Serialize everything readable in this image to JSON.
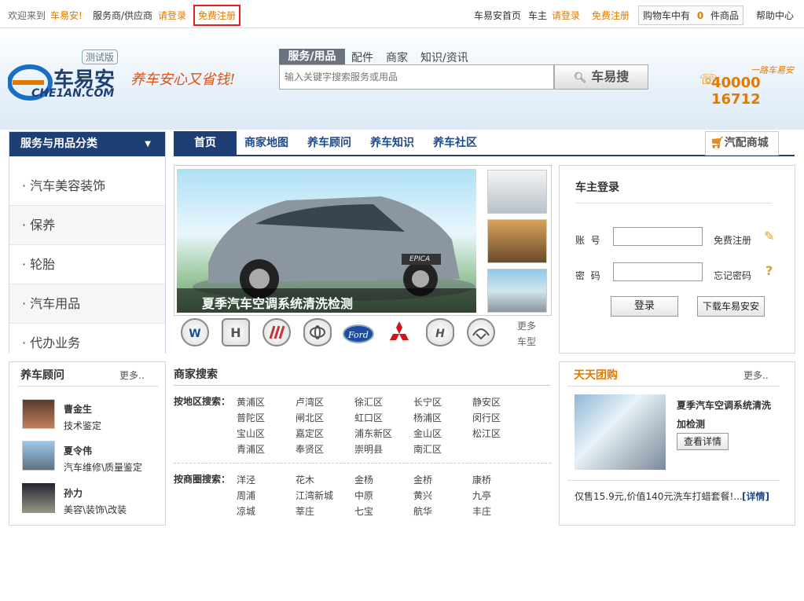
{
  "topbar": {
    "welcome": "欢迎来到",
    "brand": "车易安!",
    "provider": "服务商/供应商",
    "login": "请登录",
    "register": "免费注册",
    "home": "车易安首页",
    "owner": "车主",
    "login2": "请登录",
    "register2": "免费注册",
    "cart_pre": "购物车中有",
    "cart_count": "0",
    "cart_post": "件商品",
    "help": "帮助中心"
  },
  "header": {
    "logo_text": "车易安",
    "logo_sub": "CHE1AN.COM",
    "beta": "测试版",
    "slogan": "养车安心又省钱!",
    "search_tabs": [
      "服务/用品",
      "配件",
      "商家",
      "知识/资讯"
    ],
    "search_placeholder": "输入关键字搜索服务或用品",
    "search_button": "车易搜",
    "hotline_label": "一路车易安",
    "hotline": "40000 16712"
  },
  "left_menu": {
    "title": "服务与用品分类",
    "items": [
      "· 汽车美容装饰",
      "· 保养",
      "· 轮胎",
      "· 汽车用品",
      "· 代办业务"
    ]
  },
  "nav": {
    "tabs": [
      "首页",
      "商家地图",
      "养车顾问",
      "养车知识",
      "养车社区"
    ],
    "mall": "汽配商城"
  },
  "banner": {
    "caption": "夏季汽车空调系统清洗检测",
    "car_badge": "EPICA"
  },
  "brands": {
    "names": [
      "Volkswagen",
      "Honda",
      "Buick",
      "Toyota",
      "Ford",
      "Mitsubishi",
      "Hyundai",
      "Mazda"
    ],
    "more1": "更多",
    "more2": "车型"
  },
  "login": {
    "title": "车主登录",
    "account_label": "账  号",
    "password_label": "密  码",
    "register_link": "免费注册",
    "forgot_link": "忘记密码",
    "login_button": "登录",
    "download_button": "下载车易安安"
  },
  "advisors": {
    "title": "养车顾问",
    "more": "更多..",
    "people": [
      {
        "name": "曹金生",
        "role": "技术鉴定"
      },
      {
        "name": "夏令伟",
        "role": "汽车维修\\质量鉴定"
      },
      {
        "name": "孙力",
        "role": "美容\\装饰\\改装"
      }
    ]
  },
  "merchant_search": {
    "title": "商家搜索",
    "by_district": "按地区搜索：",
    "districts": [
      "黄浦区",
      "卢湾区",
      "徐汇区",
      "长宁区",
      "静安区",
      "普陀区",
      "闸北区",
      "虹口区",
      "杨浦区",
      "闵行区",
      "宝山区",
      "嘉定区",
      "浦东新区",
      "金山区",
      "松江区",
      "青浦区",
      "奉贤区",
      "崇明县",
      "南汇区"
    ],
    "by_circle": "按商圈搜索：",
    "circles": [
      "洋泾",
      "花木",
      "金杨",
      "金桥",
      "康桥",
      "周浦",
      "江湾新城",
      "中原",
      "黄兴",
      "九亭",
      "凉城",
      "莘庄",
      "七宝",
      "航华",
      "丰庄"
    ]
  },
  "group_buy": {
    "title": "天天团购",
    "more": "更多..",
    "item_title_1": "夏季汽车空调系统清洗",
    "item_title_2": "加检测",
    "detail_button": "查看详情",
    "promo": "仅售15.9元,价值140元洗车打蜡套餐!...",
    "promo_link": "[详情]"
  },
  "colors": {
    "accent": "#e07a00",
    "nav_blue": "#1d3f74",
    "link_blue": "#1f4a8a"
  }
}
